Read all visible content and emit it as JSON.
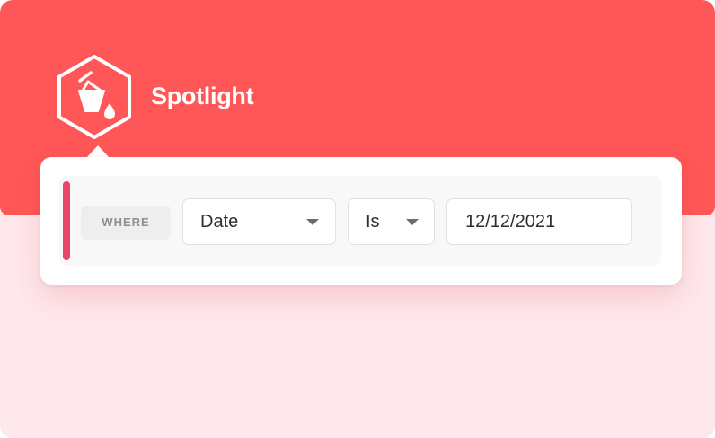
{
  "app": {
    "name": "Spotlight",
    "logo_icon": "paint-bucket-icon"
  },
  "colors": {
    "brand": "#ff5757",
    "accent": "#e8476a",
    "background": "#ffe8ec",
    "text": "#2f2f33",
    "muted": "#8e8e93"
  },
  "filter": {
    "clause_label": "WHERE",
    "field": {
      "selected": "Date",
      "icon": "chevron-down-icon"
    },
    "operator": {
      "selected": "Is",
      "icon": "chevron-down-icon"
    },
    "value": "12/12/2021"
  }
}
